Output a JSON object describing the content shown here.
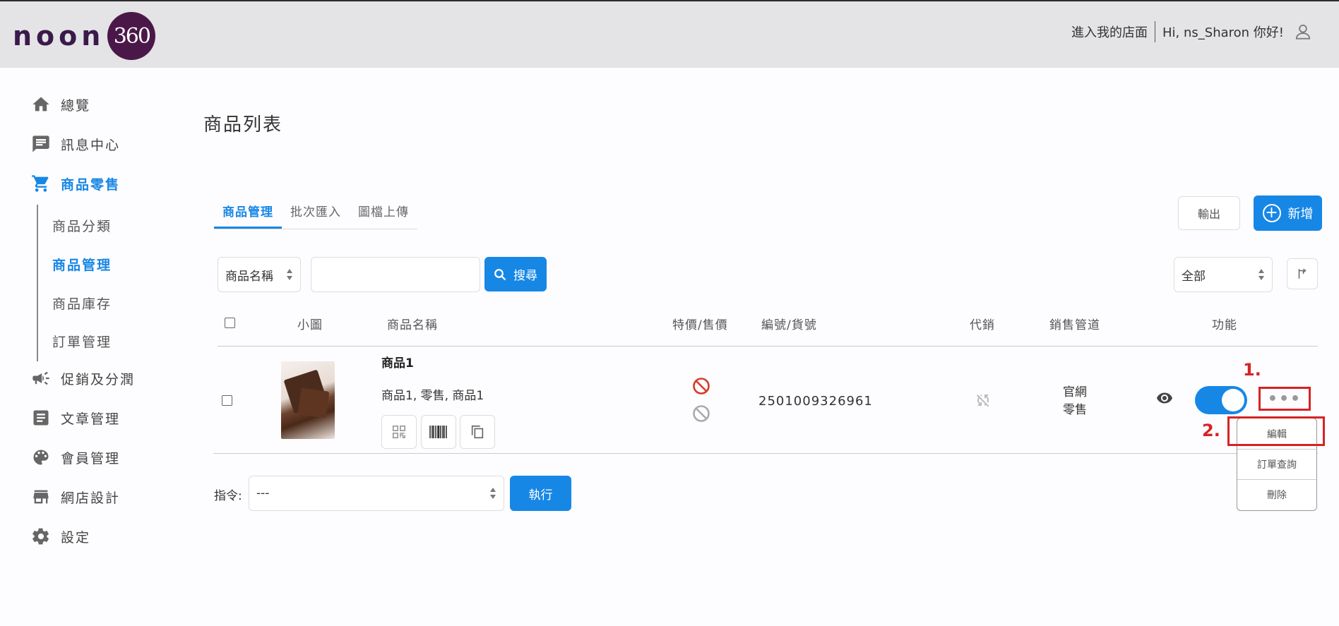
{
  "header": {
    "logo_text": "noon",
    "logo_mark": "360",
    "enter_store": "進入我的店面",
    "greeting": "Hi, ns_Sharon 你好!"
  },
  "sidebar": {
    "items": [
      {
        "label": "總覽",
        "icon": "home-icon"
      },
      {
        "label": "訊息中心",
        "icon": "message-icon"
      },
      {
        "label": "商品零售",
        "icon": "cart-icon"
      },
      {
        "label": "促銷及分潤",
        "icon": "megaphone-icon"
      },
      {
        "label": "文章管理",
        "icon": "article-icon"
      },
      {
        "label": "會員管理",
        "icon": "palette-icon"
      },
      {
        "label": "網店設計",
        "icon": "store-icon"
      },
      {
        "label": "設定",
        "icon": "gear-icon"
      }
    ],
    "sub_items": [
      "商品分類",
      "商品管理",
      "商品庫存",
      "訂單管理"
    ]
  },
  "page": {
    "title": "商品列表",
    "tabs": [
      "商品管理",
      "批次匯入",
      "圖檔上傳"
    ],
    "export_label": "輸出",
    "add_label": "新增"
  },
  "filters": {
    "field_select": "商品名稱",
    "search_value": "",
    "search_label": "搜尋",
    "status_select": "全部"
  },
  "table": {
    "headers": [
      "小圖",
      "商品名稱",
      "特價/售價",
      "編號/貨號",
      "代銷",
      "銷售管道",
      "功能"
    ],
    "rows": [
      {
        "name": "商品1",
        "subtitle": "商品1, 零售, 商品1",
        "sku": "2501009326961",
        "channel_line1": "官網",
        "channel_line2": "零售",
        "enabled": true
      }
    ]
  },
  "actions_menu": {
    "more_label": "•••",
    "items": [
      "編輯",
      "訂單查詢",
      "刪除"
    ]
  },
  "annotations": {
    "step1": "1.",
    "step2": "2."
  },
  "command": {
    "label": "指令:",
    "select_value": "---",
    "exec_label": "執行"
  },
  "colors": {
    "accent": "#1787e6",
    "annotation": "#d52424",
    "header_bg": "#e4e3e6"
  }
}
